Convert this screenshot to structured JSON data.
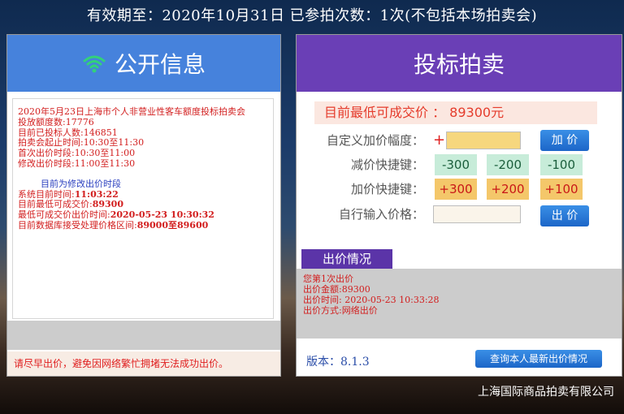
{
  "topbar": {
    "text": "有效期至：2020年10月31日 已参拍次数：1次(不包括本场拍卖会)"
  },
  "left": {
    "title": "公开信息",
    "lines": [
      "2020年5月23日上海市个人非营业性客车额度投标拍卖会",
      "投放额度数:17776",
      "目前已投标人数:146851",
      "拍卖会起止时间:10:30至11:30",
      "首次出价时段:10:30至11:00",
      "修改出价时段:11:00至11:30"
    ],
    "blue_line": "目前为修改出价时段",
    "status": [
      {
        "label": "系统目前时间:",
        "value": "11:03:22"
      },
      {
        "label": "目前最低可成交价:",
        "value": "89300"
      },
      {
        "label": "最低可成交价出价时间:",
        "value": "2020-05-23 10:30:32"
      },
      {
        "label": "目前数据库接受处理价格区间:",
        "value": "89000至89600"
      }
    ],
    "notice": "请尽早出价，避免因网络繁忙拥堵无法成功出价。"
  },
  "right": {
    "title": "投标拍卖",
    "lowest_price": "目前最低可成交价 ：  89300元",
    "custom_label": "自定义加价幅度：",
    "plus_sign": "+",
    "add_button": "加 价",
    "decrease_label": "减价快捷键：",
    "decrease_options": [
      "-300",
      "-200",
      "-100"
    ],
    "increase_label": "加价快捷键：",
    "increase_options": [
      "+300",
      "+200",
      "+100"
    ],
    "manual_label": "自行输入价格：",
    "bid_button": "出 价",
    "history_title": "出价情况",
    "history_lines": [
      "您第1次出价",
      "出价金额:89300",
      "出价时间:  2020-05-23  10:33:28",
      "出价方式:网络出价"
    ],
    "version": "版本：8.1.3",
    "query_button": "查询本人最新出价情况"
  },
  "footer": {
    "company": "上海国际商品拍卖有限公司"
  },
  "colors": {
    "left_header": "#4682dc",
    "right_header": "#6a3fb6",
    "alert_text": "#d21e1e"
  }
}
